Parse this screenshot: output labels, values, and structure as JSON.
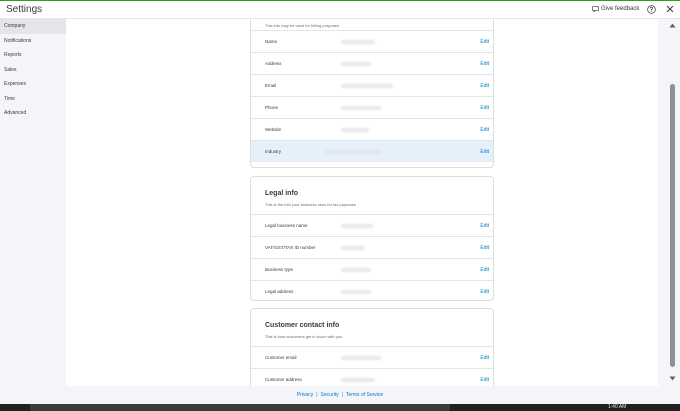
{
  "header": {
    "title": "Settings",
    "feedback_label": "Give feedback",
    "icons": [
      "feedback-icon",
      "help-icon",
      "close-icon"
    ]
  },
  "sidebar": {
    "items": [
      {
        "label": "Company",
        "active": true
      },
      {
        "label": "Notifications"
      },
      {
        "label": "Reports"
      },
      {
        "label": "Sales"
      },
      {
        "label": "Expenses"
      },
      {
        "label": "Time"
      },
      {
        "label": "Advanced"
      }
    ]
  },
  "cards": {
    "company": {
      "description": "This info may be used for billing purposes",
      "rows": [
        {
          "label": "Name",
          "edit": "Edit"
        },
        {
          "label": "Address",
          "edit": "Edit"
        },
        {
          "label": "Email",
          "edit": "Edit"
        },
        {
          "label": "Phone",
          "edit": "Edit"
        },
        {
          "label": "Website",
          "edit": "Edit"
        },
        {
          "label": "Industry",
          "edit": "Edit",
          "highlighted": true
        }
      ]
    },
    "legal": {
      "title": "Legal info",
      "description": "This is the info your business uses for tax purposes",
      "rows": [
        {
          "label": "Legal business name",
          "edit": "Edit"
        },
        {
          "label": "VAT/GST/TAX ID number",
          "edit": "Edit"
        },
        {
          "label": "Business type",
          "edit": "Edit"
        },
        {
          "label": "Legal address",
          "edit": "Edit"
        }
      ]
    },
    "customer": {
      "title": "Customer contact info",
      "description": "This is how customers get in touch with you",
      "rows": [
        {
          "label": "Customer email",
          "edit": "Edit"
        },
        {
          "label": "Customer address",
          "edit": "Edit"
        }
      ]
    }
  },
  "footer": {
    "links": [
      "Privacy",
      "Security",
      "Terms of Service"
    ],
    "separator": "|"
  },
  "taskbar": {
    "clock": "1:40 AM"
  },
  "colors": {
    "accent": "#2ca01c",
    "link": "#0077c5",
    "highlight_row": "#e6f0fb"
  }
}
